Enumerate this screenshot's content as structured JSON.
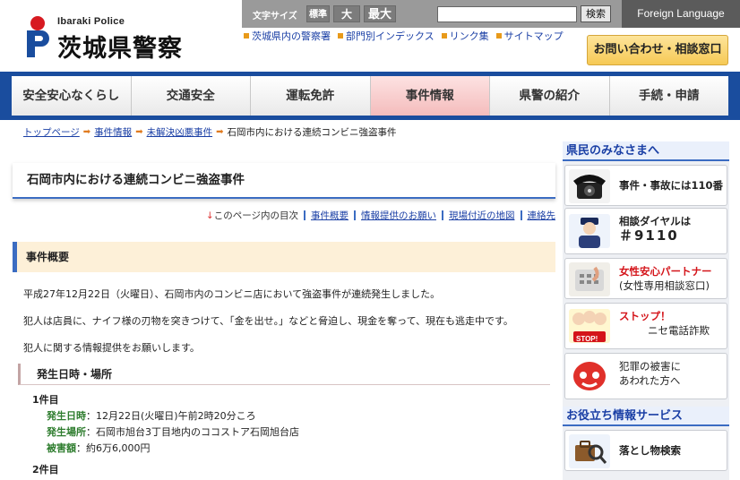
{
  "header": {
    "logo_sub": "Ibaraki Police",
    "logo_main": "茨城県警察",
    "fontsize_label": "文字サイズ",
    "fontsize_std": "標準",
    "fontsize_big": "大",
    "fontsize_max": "最大",
    "search_value": "",
    "search_button": "検索",
    "foreign_language": "Foreign Language",
    "sublinks": [
      "茨城県内の警察署",
      "部門別インデックス",
      "リンク集",
      "サイトマップ"
    ],
    "contact_button": "お問い合わせ・相談窓口"
  },
  "gnav": [
    "安全安心なくらし",
    "交通安全",
    "運転免許",
    "事件情報",
    "県警の紹介",
    "手続・申請"
  ],
  "breadcrumb": {
    "items": [
      "トップページ",
      "事件情報",
      "未解決凶悪事件"
    ],
    "current": "石岡市内における連続コンビニ強盗事件"
  },
  "main": {
    "title": "石岡市内における連続コンビニ強盗事件",
    "toc_label": "このページ内の目次",
    "toc_arrow": "↓",
    "toc_links": [
      "事件概要",
      "情報提供のお願い",
      "現場付近の地図",
      "連絡先"
    ],
    "sec1": "事件概要",
    "p1": "平成27年12月22日（火曜日）、石岡市内のコンビニ店において強盗事件が連続発生しました。",
    "p2": "犯人は店員に、ナイフ様の刃物を突きつけて、「金を出せ。」などと脅迫し、現金を奪って、現在も逃走中です。",
    "p3": "犯人に関する情報提供をお願いします。",
    "sec2": "発生日時・場所",
    "case1": "1件目",
    "d1_k": "発生日時",
    "d1_v": "：12月22日(火曜日)午前2時20分ころ",
    "d2_k": "発生場所",
    "d2_v": "：石岡市旭台3丁目地内のココストア石岡旭台店",
    "d3_k": "被害額",
    "d3_v": "：約6万6,000円",
    "case2": "2件目"
  },
  "side": {
    "h1": "県民のみなさまへ",
    "card1": "事件・事故には110番",
    "card2_l1": "相談ダイヤルは",
    "card2_l2": "＃9110",
    "card3_l1": "女性安心パートナー",
    "card3_l2": "(女性専用相談窓口)",
    "card4_l1": "ストップ！",
    "card4_l2": "ニセ電話詐欺",
    "card4_stop": "STOP!",
    "card5_l1": "犯罪の被害に",
    "card5_l2": "あわれた方へ",
    "h2": "お役立ち情報サービス",
    "card6": "落とし物検索"
  }
}
